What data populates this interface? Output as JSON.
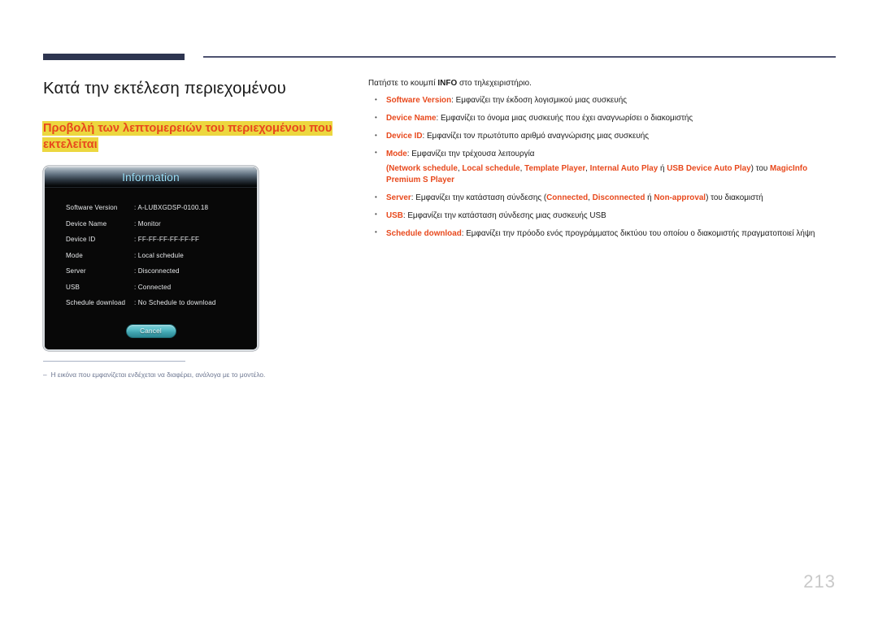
{
  "page": {
    "number": "213",
    "heading": "Κατά την εκτέλεση περιεχομένου",
    "subheading_line1": "Προβολή των λεπτομερειών του περιεχομένου που",
    "subheading_line2": "εκτελείται",
    "accent_color": "#e8491d",
    "highlight_color": "#ecd73f",
    "rule_color": "#2e3550"
  },
  "osd_dialog": {
    "title": "Information",
    "rows": [
      {
        "label": "Software Version",
        "value": ": A-LUBXGDSP-0100.18"
      },
      {
        "label": "Device Name",
        "value": ": Monitor"
      },
      {
        "label": "Device ID",
        "value": ": FF-FF-FF-FF-FF-FF"
      },
      {
        "label": "Mode",
        "value": ": Local schedule"
      },
      {
        "label": "Server",
        "value": ": Disconnected"
      },
      {
        "label": "USB",
        "value": ": Connected"
      },
      {
        "label": "Schedule download",
        "value": ": No Schedule to download"
      }
    ],
    "cancel_label": "Cancel",
    "title_text_color": "#9fe5ff",
    "button_color": "#3fa3af"
  },
  "footnote": {
    "dash": "–",
    "text": "Η εικόνα που εμφανίζεται ενδέχεται να διαφέρει, ανάλογα με το μοντέλο."
  },
  "description": {
    "intro_before": "Πατήστε το κουμπί ",
    "intro_bold": "INFO",
    "intro_after": " στο τηλεχειριστήριο.",
    "bullets": [
      {
        "term": "Software Version",
        "rest": ": Εμφανίζει την έκδοση λογισμικού μιας συσκευής"
      },
      {
        "term": "Device Name",
        "rest": ": Εμφανίζει το όνομα μιας συσκευής που έχει αναγνωρίσει ο διακομιστής"
      },
      {
        "term": "Device ID",
        "rest": ": Εμφανίζει τον πρωτότυπο αριθμό αναγνώρισης μιας συσκευής"
      },
      {
        "term": "Mode",
        "rest": ": Εμφανίζει την τρέχουσα λειτουργία",
        "sub": {
          "open_paren": "(",
          "options": [
            "Network schedule",
            "Local schedule",
            "Template Player",
            "Internal Auto Play"
          ],
          "separator": ", ",
          "or_word": " ή ",
          "last_option": "USB Device Auto Play",
          "close_paren": ") του ",
          "brand": "MagicInfo Premium S Player"
        }
      },
      {
        "term": "Server",
        "rest_a": ": Εμφανίζει την κατάσταση σύνδεσης (",
        "states": [
          "Connected",
          "Disconnected"
        ],
        "or_word": " ή ",
        "last_state": "Non-approval",
        "rest_b": ") του διακομιστή"
      },
      {
        "term": "USB",
        "rest": ": Εμφανίζει την κατάσταση σύνδεσης μιας συσκευής USB"
      },
      {
        "term": "Schedule download",
        "rest": ": Εμφανίζει την πρόοδο ενός προγράμματος δικτύου του οποίου ο διακομιστής πραγματοποιεί λήψη"
      }
    ]
  }
}
